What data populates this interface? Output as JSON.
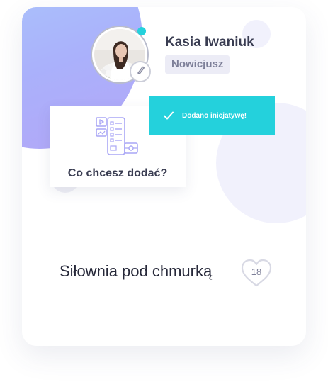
{
  "profile": {
    "name": "Kasia Iwaniuk",
    "rank": "Nowicjusz",
    "online": true,
    "avatar_icon": "user-avatar-photo",
    "edit_icon": "pencil-icon"
  },
  "add_card": {
    "label": "Co chcesz dodać?",
    "icon": "add-content-icon"
  },
  "toast": {
    "message": "Dodano inicjatywę!",
    "icon": "check-icon"
  },
  "initiative": {
    "title": "Siłownia pod chmurką",
    "likes": "18",
    "like_icon": "heart-icon"
  },
  "colors": {
    "accent": "#24d1dc",
    "text_dark": "#27293a",
    "text_muted": "#7d7f98",
    "badge_bg": "#ececf6",
    "icon_lilac": "#a9a6f5"
  }
}
